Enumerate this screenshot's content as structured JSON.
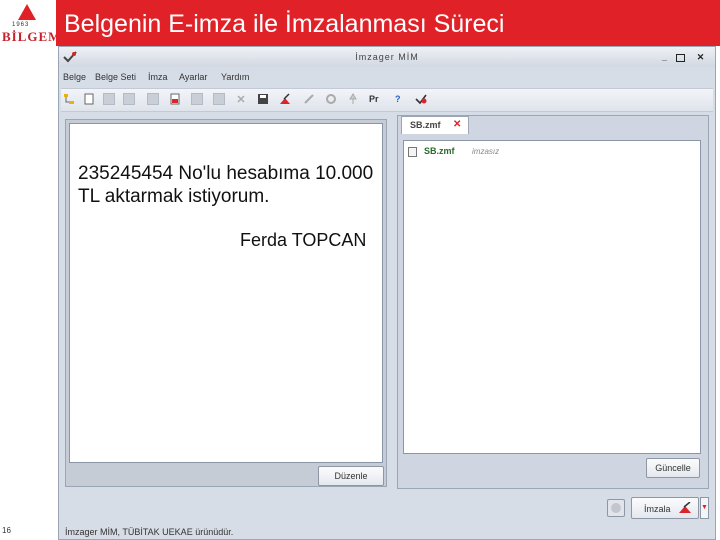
{
  "slide": {
    "title": "Belgenin E-imza ile İmzalanması Süreci",
    "number": "16",
    "logo": {
      "small_text": "1963",
      "text": "BİLGEM"
    }
  },
  "colors": {
    "title_bar": "#e02228",
    "accent_red": "#d9252b",
    "window_bg": "#d7dde7"
  },
  "window": {
    "title": "İmzager MİM",
    "buttons": [
      "minimize",
      "restore",
      "close"
    ]
  },
  "menu": [
    "Belge",
    "Belge Seti",
    "İmza",
    "Ayarlar",
    "Yardım"
  ],
  "toolbar": {
    "icons": [
      "tree-icon",
      "new-document-icon",
      "copy-icon",
      "list-icon",
      "document-icon",
      "red-document-icon",
      "copy-icon",
      "blank-icon",
      "cut-icon",
      "save-icon",
      "sign-red-icon",
      "pen-icon",
      "settings-icon",
      "pin-icon",
      "pr-text",
      "help-icon",
      "sign-check-icon"
    ],
    "pr_label": "Pr",
    "help_label": "?"
  },
  "document": {
    "content": "235245454 No'lu hesabıma 10.000 TL aktarmak istiyorum.",
    "signature": "Ferda TOPCAN",
    "edit_button": "Düzenle"
  },
  "file_panel": {
    "tab_label": "SB.zmf",
    "files": [
      {
        "name": "SB.zmf",
        "status": "imzasız"
      }
    ],
    "refresh_button": "Güncelle"
  },
  "sign_button": "İmzala",
  "status_bar": "İmzager MİM, TÜBİTAK UEKAE ürünüdür."
}
